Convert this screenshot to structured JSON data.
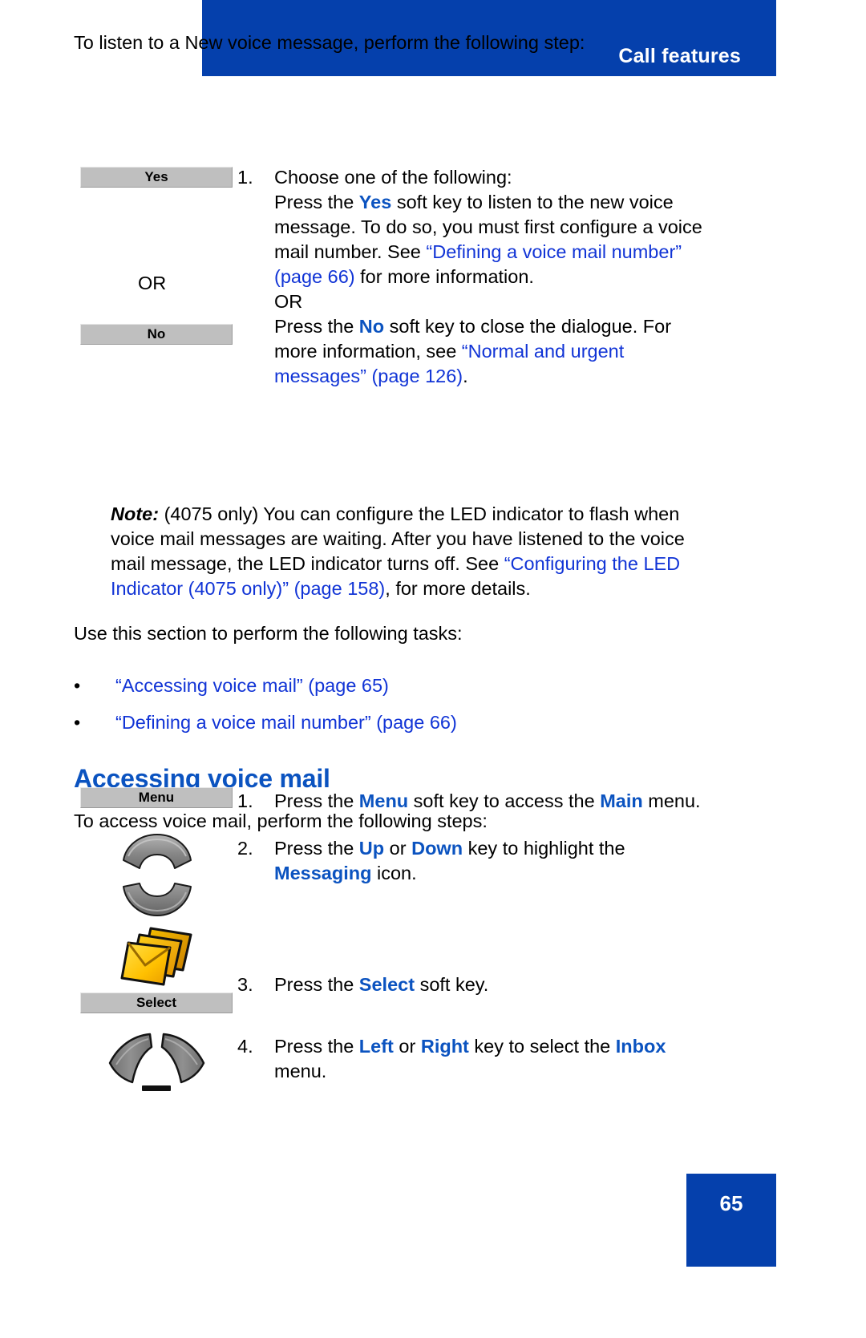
{
  "header": {
    "title": "Call features",
    "banner_color": "#0540AC"
  },
  "body": {
    "lead_1": "To listen to a New voice message, perform the following step:",
    "step1": {
      "number": "1.",
      "line1": "Choose one of the following:",
      "line2_a": "Press the ",
      "line2_key": "Yes",
      "line2_b": " soft key to listen to the new voice",
      "line3": "message. To do so, you must first configure a voice",
      "line4_a": "mail number. See ",
      "line4_link": "“Defining a voice mail number”",
      "line5_link": "(page 66)",
      "line5_b": " for more information.",
      "line6": "OR",
      "line7_a": "Press the ",
      "line7_key": "No",
      "line7_b": " soft key to close the dialogue. For",
      "line8_a": "more information, see ",
      "line8_link": "“Normal and urgent",
      "line9_link": "messages” (page 126)",
      "line9_b": "."
    },
    "softkey_yes": "Yes",
    "softkey_no": "No",
    "or_label": "OR",
    "note": {
      "label": "Note:",
      "line1": " (4075 only) You can configure the LED indicator to flash when",
      "line2": "voice mail messages are waiting. After you have listened to the voice",
      "line3_a": "mail message, the LED indicator turns off. See ",
      "line3_link": "“Configuring the LED",
      "line4_link": "Indicator (4075 only)” (page 158)",
      "line4_b": ", for more details."
    },
    "lead_2": "Use this section to perform the following tasks:",
    "bullets": [
      {
        "dot": "•",
        "text": "“Accessing voice mail” (page 65)"
      },
      {
        "dot": "•",
        "text": "“Defining a voice mail number” (page 66)"
      }
    ],
    "section_heading": "Accessing voice mail",
    "lead_3": "To access voice mail, perform the following steps:",
    "softkey_menu": "Menu",
    "softkey_select": "Select",
    "steps": {
      "s1": {
        "number": "1.",
        "a": "Press the ",
        "key1": "Menu",
        "b": " soft key to access the ",
        "key2": "Main",
        "c": " menu."
      },
      "s2": {
        "number": "2.",
        "a": "Press the ",
        "key1": "Up",
        "b": " or ",
        "key2": "Down",
        "c": " key to highlight the",
        "key3": "Messaging",
        "d": " icon."
      },
      "s3": {
        "number": "3.",
        "a": "Press the ",
        "key1": "Select",
        "b": " soft key."
      },
      "s4": {
        "number": "4.",
        "a": "Press the ",
        "key1": "Left",
        "b": " or ",
        "key2": "Right",
        "c": " key to select the ",
        "key3": "Inbox",
        "d": "menu."
      }
    },
    "icons": {
      "up_key": "nav-up-key-icon",
      "down_key": "nav-down-key-icon",
      "messaging": "messaging-envelopes-icon",
      "left_key": "nav-left-key-icon",
      "right_key": "nav-right-key-icon"
    }
  },
  "footer": {
    "page_number": "65"
  },
  "colors": {
    "brand_blue": "#0540AC",
    "link_blue": "#1134D6",
    "heading_blue": "#0B53C0",
    "softkey_gray": "#BFBFBF"
  }
}
